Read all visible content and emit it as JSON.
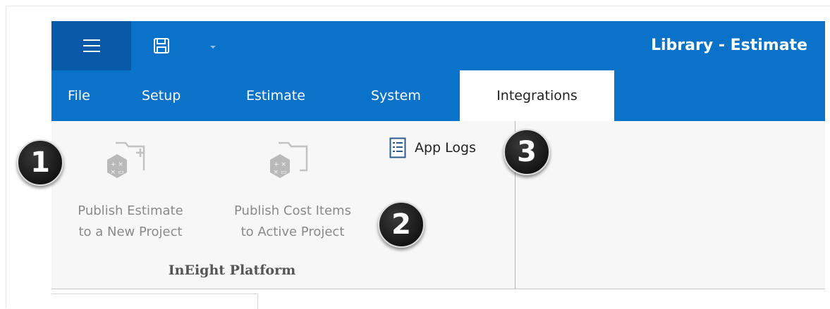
{
  "title": "Library - Estimate",
  "toolbar": {
    "menu_icon": "hamburger-icon",
    "save_icon": "save-icon",
    "dropdown_icon": "chevron-down-icon"
  },
  "tabs": [
    {
      "label": "File"
    },
    {
      "label": "Setup"
    },
    {
      "label": "Estimate"
    },
    {
      "label": "System"
    },
    {
      "label": "Integrations"
    }
  ],
  "active_tab": "Integrations",
  "ribbon": {
    "publish_new": {
      "line1": "Publish Estimate",
      "line2": "to a New Project",
      "icon": "folder-calculator-add-icon"
    },
    "publish_active": {
      "line1": "Publish Cost Items",
      "line2": "to Active Project",
      "icon": "folder-calculator-icon"
    },
    "group_label": "InEight Platform",
    "app_logs": {
      "label": "App Logs",
      "icon": "document-lines-icon"
    }
  },
  "callouts": [
    "1",
    "2",
    "3"
  ],
  "colors": {
    "brand_blue": "#0a72c9",
    "menu_blue": "#0859a8",
    "ribbon_bg": "#f7f7f7",
    "disabled_text": "#8a8a8a"
  }
}
